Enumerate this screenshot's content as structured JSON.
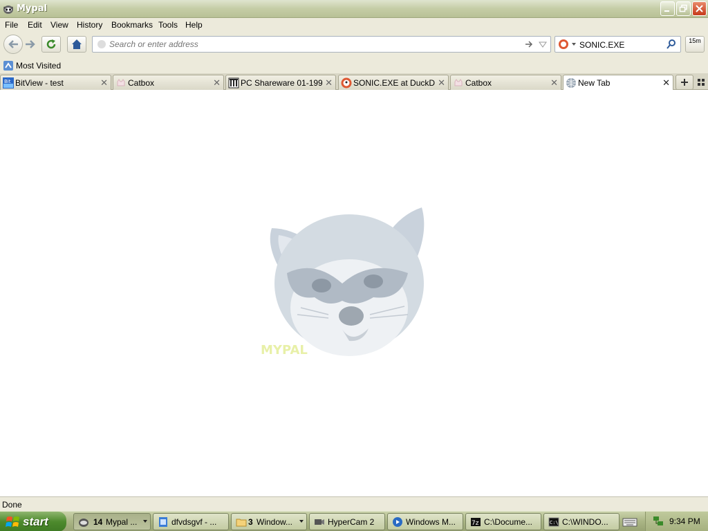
{
  "window": {
    "title": "Mypal"
  },
  "menu": [
    "File",
    "Edit",
    "View",
    "History",
    "Bookmarks",
    "Tools",
    "Help"
  ],
  "address_bar": {
    "placeholder": "Search or enter address"
  },
  "search_bar": {
    "value": "SONIC.EXE"
  },
  "timer_button": "15m",
  "bookmarks": [
    {
      "label": "Most Visited"
    }
  ],
  "tabs": [
    {
      "label": "BitView - test",
      "icon": "bitview-icon",
      "active": false
    },
    {
      "label": "Catbox",
      "icon": "catbox-icon",
      "active": false
    },
    {
      "label": "PC Shareware 01-199…",
      "icon": "archive-icon",
      "active": false
    },
    {
      "label": "SONIC.EXE at DuckDu…",
      "icon": "duckduckgo-icon",
      "active": false
    },
    {
      "label": "Catbox",
      "icon": "catbox-icon",
      "active": false
    },
    {
      "label": "New Tab",
      "icon": "globe-icon",
      "active": true
    }
  ],
  "content": {
    "logo_text": "MYPAL"
  },
  "status": {
    "text": "Done"
  },
  "taskbar": {
    "start_label": "start",
    "tasks": [
      {
        "count": "14",
        "label": "Mypal ...",
        "active": true
      },
      {
        "label": "dfvdsgvf - ...",
        "active": false
      },
      {
        "count": "3",
        "label": "Window...",
        "active": false
      },
      {
        "label": "HyperCam 2",
        "active": false
      },
      {
        "label": "Windows M...",
        "active": false
      },
      {
        "label": "C:\\Docume...",
        "active": false
      },
      {
        "label": "C:\\WINDO...",
        "active": false
      }
    ],
    "clock": "9:34 PM"
  }
}
